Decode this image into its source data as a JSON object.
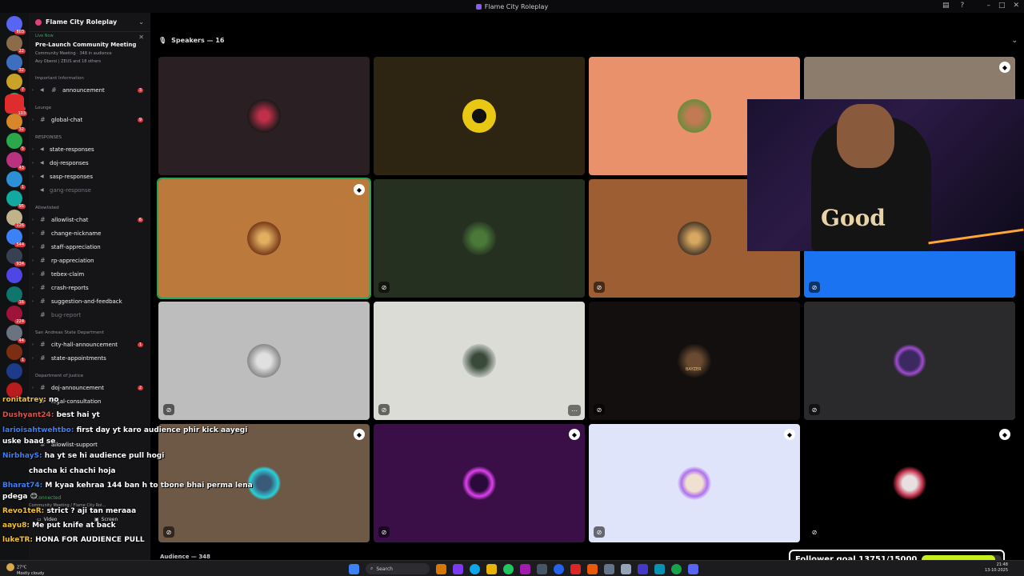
{
  "window": {
    "title": "Flame City Roleplay"
  },
  "server": {
    "name": "Flame City Roleplay",
    "event": {
      "status": "Live Now",
      "title": "Pre-Launch Community Meeting",
      "meta": "Community Meeting · 348 in audience",
      "people": "Avy Oberoi | ZEUS and 18 others"
    }
  },
  "channels": {
    "important_label": "Important Information",
    "lounge_label": "Lounge",
    "responses_label": "RESPONSES",
    "allowlisted_label": "Allowlisted",
    "sasd_label": "San Andreas State Department",
    "doj_label": "Department of Justice",
    "items": [
      {
        "name": "announcement",
        "badge": "3"
      },
      {
        "name": "global-chat",
        "badge": "9"
      },
      {
        "name": "state-responses",
        "badge": ""
      },
      {
        "name": "doj-responses",
        "badge": ""
      },
      {
        "name": "sasp-responses",
        "badge": ""
      },
      {
        "name": "gang-response",
        "badge": ""
      },
      {
        "name": "allowlist-chat",
        "badge": "6"
      },
      {
        "name": "change-nickname",
        "badge": ""
      },
      {
        "name": "staff-appreciation",
        "badge": ""
      },
      {
        "name": "rp-appreciation",
        "badge": ""
      },
      {
        "name": "tebex-claim",
        "badge": ""
      },
      {
        "name": "crash-reports",
        "badge": ""
      },
      {
        "name": "suggestion-and-feedback",
        "badge": ""
      },
      {
        "name": "bug-report",
        "badge": ""
      },
      {
        "name": "city-hall-announcement",
        "badge": "1"
      },
      {
        "name": "state-appointments",
        "badge": ""
      },
      {
        "name": "doj-announcement",
        "badge": "2"
      },
      {
        "name": "legal-consultation",
        "badge": ""
      },
      {
        "name": "allowlist-support",
        "badge": ""
      }
    ]
  },
  "rail_badges": [
    "803",
    "22",
    "32",
    "7",
    "45",
    "103",
    "32",
    "5",
    "43",
    "1",
    "95",
    "126",
    "544",
    "934",
    "16",
    "224",
    "44",
    "1"
  ],
  "voice": {
    "speakers_label": "Speakers — 16",
    "audience_label": "Audience — 348",
    "connected": "Connected",
    "meta": "Community Meeting / Flame City Rol...",
    "video_label": "Video",
    "screen_label": "Screen",
    "in_voice": "IN VOICE"
  },
  "chat": [
    {
      "user": "ronitatrey:",
      "msg": "no",
      "ucls": "u"
    },
    {
      "user": "Dushyant24:",
      "msg": "best hai yt",
      "ucls": "u2"
    },
    {
      "user": "larioisahtwehtbo:",
      "msg": "first day yt karo audience phir kick aayegi",
      "ucls": "u3"
    },
    {
      "user": "",
      "msg": "uske baad se",
      "ucls": "u"
    },
    {
      "user": "NirbhayS:",
      "msg": "ha yt se hi audience pull hogi",
      "ucls": "u3"
    },
    {
      "user": "",
      "msg": "chacha ki chachi hoja",
      "ucls": "u"
    },
    {
      "user": "Bharat74:",
      "msg": "M kyaa kehraa 144 ban h to tbone bhai perma lena",
      "ucls": "u3"
    },
    {
      "user": "",
      "msg": "pdega 😊",
      "ucls": "u"
    },
    {
      "user": "Revo1teR:",
      "msg": "strict ? aji tan meraaa",
      "ucls": "u"
    },
    {
      "user": "aayu8:",
      "msg": "Me put knife at back",
      "ucls": "u3"
    },
    {
      "user": "lukeTR:",
      "msg": "HONA FOR AUDIENCE PULL",
      "ucls": "u"
    }
  ],
  "goal": {
    "label": "Follower goal 13751/15000",
    "current": 13751,
    "target": 15000
  },
  "taskbar": {
    "weather_temp": "27°C",
    "weather_desc": "Mostly cloudy",
    "search": "Search",
    "time": "21:48",
    "date": "13-10-2025"
  },
  "tile_names": [
    "BAYZER"
  ],
  "colors": {
    "live": "#3ba55d",
    "badge": "#da373c",
    "goal_fill": "#c6f01a",
    "selected": "#23a55a"
  }
}
